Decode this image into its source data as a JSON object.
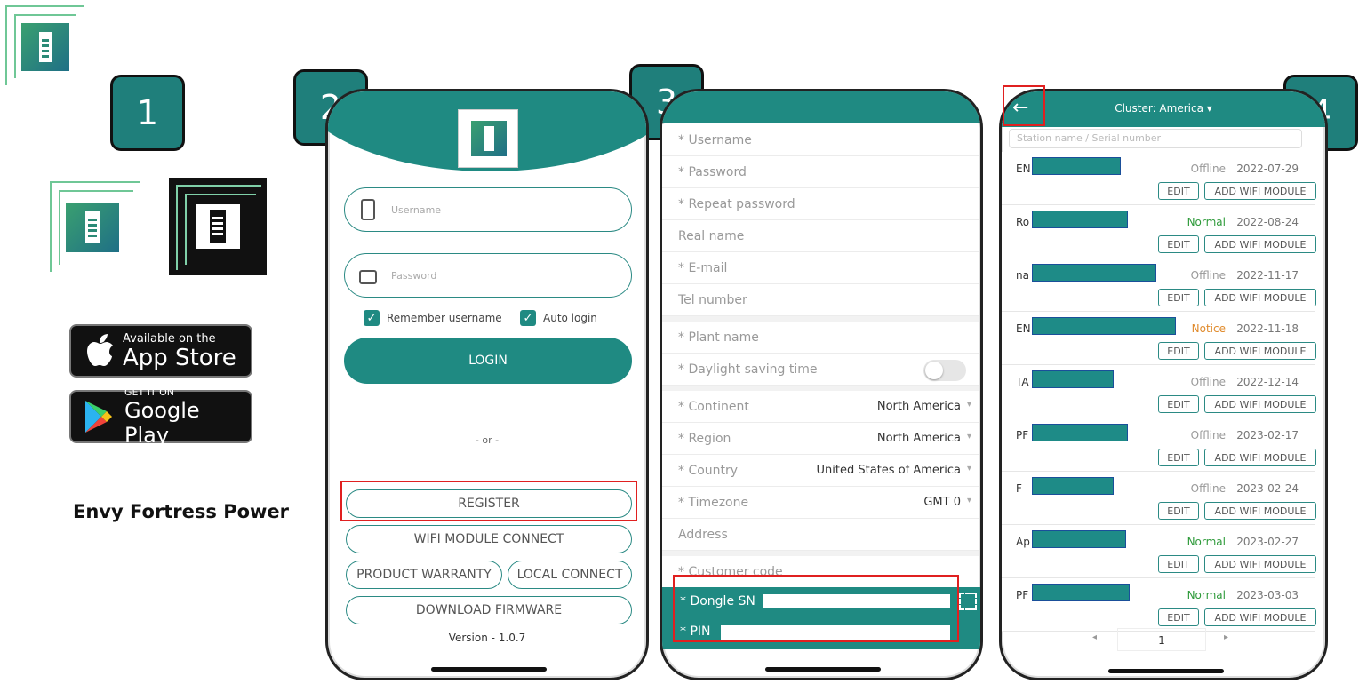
{
  "steps": [
    "1",
    "2",
    "3",
    "4"
  ],
  "brand": {
    "name": "Envy Fortress Power"
  },
  "stores": {
    "apple_small": "Available on the",
    "apple_big": "App Store",
    "google_small": "GET IT ON",
    "google_big": "Google Play"
  },
  "login_screen": {
    "username_placeholder": "Username",
    "password_placeholder": "Password",
    "remember_label": "Remember username",
    "auto_login_label": "Auto login",
    "login_button": "LOGIN",
    "or_text": "- or -",
    "register_button": "REGISTER",
    "wifi_button": "WIFI MODULE CONNECT",
    "warranty_button": "PRODUCT WARRANTY",
    "local_button": "LOCAL CONNECT",
    "firmware_button": "DOWNLOAD FIRMWARE",
    "version": "Version - 1.0.7"
  },
  "register_screen": {
    "fields": [
      {
        "label": "* Username",
        "value": ""
      },
      {
        "label": "* Password",
        "value": ""
      },
      {
        "label": "* Repeat password",
        "value": ""
      },
      {
        "label": "Real name",
        "value": ""
      },
      {
        "label": "* E-mail",
        "value": ""
      },
      {
        "label": "Tel number",
        "value": ""
      }
    ],
    "plant_name": "* Plant name",
    "daylight": "* Daylight saving time",
    "location_fields": [
      {
        "label": "* Continent",
        "value": "North America"
      },
      {
        "label": "* Region",
        "value": "North America"
      },
      {
        "label": "* Country",
        "value": "United States of America"
      },
      {
        "label": "* Timezone",
        "value": "GMT 0"
      }
    ],
    "address": "Address",
    "customer_code": "* Customer code",
    "dongle_label": "* Dongle SN",
    "pin_label": "* PIN"
  },
  "station_screen": {
    "cluster": "Cluster: America",
    "search_placeholder": "Station name / Serial number",
    "edit_label": "EDIT",
    "add_label": "ADD WIFI MODULE",
    "stations": [
      {
        "prefix": "EN",
        "status": "Offline",
        "date": "2022-07-29",
        "color": "#999999"
      },
      {
        "prefix": "Ro",
        "status": "Normal",
        "date": "2022-08-24",
        "color": "#2e9a3a"
      },
      {
        "prefix": "na",
        "status": "Offline",
        "date": "2022-11-17",
        "color": "#999999"
      },
      {
        "prefix": "EN",
        "status": "Notice",
        "date": "2022-11-18",
        "color": "#e08a2b"
      },
      {
        "prefix": "TA",
        "status": "Offline",
        "date": "2022-12-14",
        "color": "#999999"
      },
      {
        "prefix": "PF",
        "status": "Offline",
        "date": "2023-02-17",
        "color": "#999999"
      },
      {
        "prefix": "F",
        "status": "Offline",
        "date": "2023-02-24",
        "color": "#999999"
      },
      {
        "prefix": "Ap",
        "status": "Normal",
        "date": "2023-02-27",
        "color": "#2e9a3a"
      },
      {
        "prefix": "PF",
        "status": "Normal",
        "date": "2023-03-03",
        "color": "#2e9a3a"
      }
    ],
    "page": "1"
  },
  "colors": {
    "teal": "#1f8a82",
    "highlight": "#e02020"
  }
}
